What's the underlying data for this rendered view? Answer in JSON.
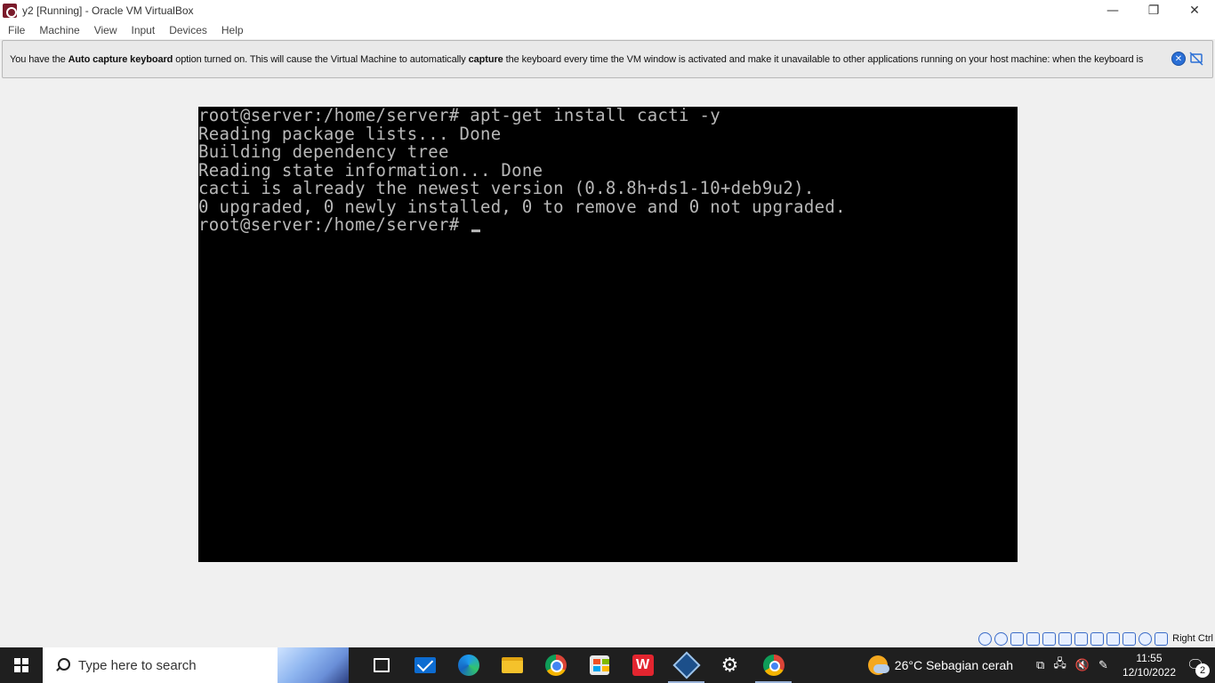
{
  "window": {
    "title": "y2 [Running] - Oracle VM VirtualBox",
    "minimize_symbol": "—",
    "restore_symbol": "❐",
    "close_symbol": "✕"
  },
  "menu": {
    "items": [
      "File",
      "Machine",
      "View",
      "Input",
      "Devices",
      "Help"
    ]
  },
  "notice": {
    "part1": "You have the ",
    "bold1": "Auto capture keyboard",
    "part2": " option turned on. This will cause the Virtual Machine to automatically ",
    "bold2": "capture",
    "part3": " the keyboard every time the VM window is activated and make it unavailable to other applications running on your host machine: when the keyboard is"
  },
  "terminal": {
    "lines": [
      "root@server:/home/server# apt-get install cacti -y",
      "Reading package lists... Done",
      "Building dependency tree",
      "Reading state information... Done",
      "cacti is already the newest version (0.8.8h+ds1-10+deb9u2).",
      "0 upgraded, 0 newly installed, 0 to remove and 0 not upgraded.",
      "root@server:/home/server# "
    ]
  },
  "statusbar": {
    "host_key": "Right Ctrl"
  },
  "taskbar": {
    "search_placeholder": "Type here to search",
    "weather": "26°C  Sebagian cerah",
    "time": "11:55",
    "date": "12/10/2022",
    "notification_count": "2"
  }
}
